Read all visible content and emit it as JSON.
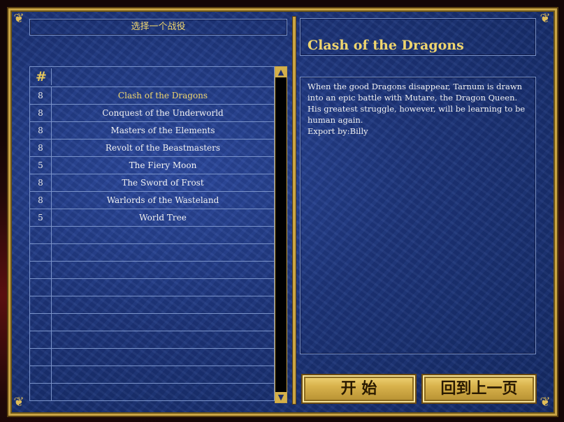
{
  "header": {
    "title": "选择一个战役"
  },
  "list": {
    "header_icon": "hash-icon",
    "rows": [
      {
        "num": "8",
        "name": "Clash of the Dragons",
        "selected": true
      },
      {
        "num": "8",
        "name": "Conquest of the Underworld"
      },
      {
        "num": "8",
        "name": "Masters of the Elements"
      },
      {
        "num": "8",
        "name": "Revolt of the Beastmasters"
      },
      {
        "num": "5",
        "name": "The Fiery Moon"
      },
      {
        "num": "8",
        "name": "The Sword of Frost"
      },
      {
        "num": "8",
        "name": "Warlords of the Wasteland"
      },
      {
        "num": "5",
        "name": "World Tree"
      },
      {
        "num": "",
        "name": ""
      },
      {
        "num": "",
        "name": ""
      },
      {
        "num": "",
        "name": ""
      },
      {
        "num": "",
        "name": ""
      },
      {
        "num": "",
        "name": ""
      },
      {
        "num": "",
        "name": ""
      },
      {
        "num": "",
        "name": ""
      },
      {
        "num": "",
        "name": ""
      },
      {
        "num": "",
        "name": ""
      },
      {
        "num": "",
        "name": ""
      }
    ]
  },
  "details": {
    "title": "Clash of the Dragons",
    "description": [
      "When the good Dragons disappear, Tarnum is drawn",
      "into an epic battle with Mutare, the Dragon Queen.",
      "His greatest struggle, however, will be learning to be",
      "human again.",
      "Export by:Billy"
    ]
  },
  "buttons": {
    "start": "开  始",
    "back": "回到上一页"
  },
  "colors": {
    "frame_gold": "#c9a445",
    "panel_blue": "#1d3579",
    "text_gold": "#f0d66e"
  }
}
